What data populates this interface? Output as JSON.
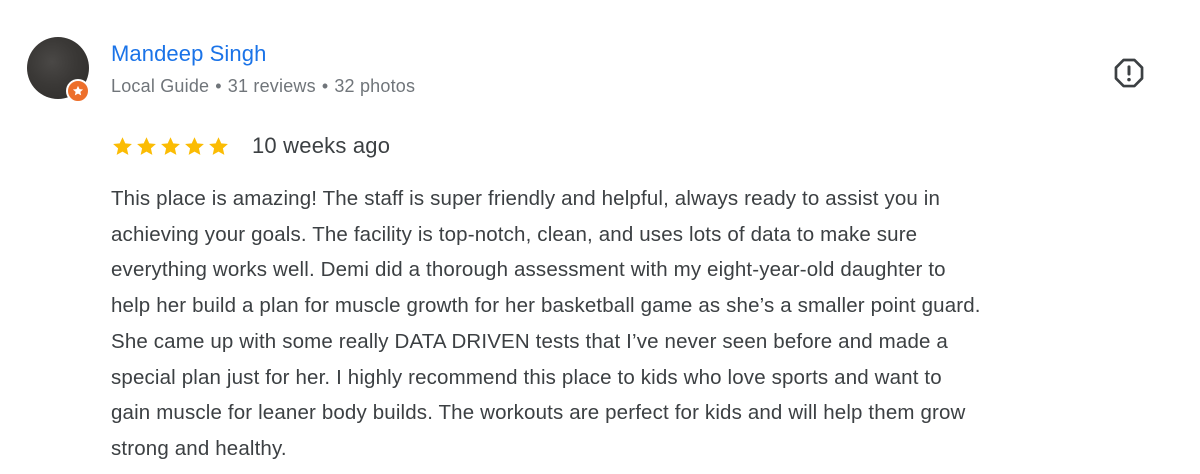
{
  "review": {
    "author": {
      "name": "Mandeep Singh",
      "badge_icon": "local-guide-star-icon",
      "meta": {
        "level": "Local Guide",
        "reviews": "31 reviews",
        "photos": "32 photos",
        "separator": "•"
      }
    },
    "report_icon": "report-octagon-icon",
    "rating": {
      "stars": 5,
      "max": 5,
      "star_color": "#fbbc04"
    },
    "time_ago": "10 weeks ago",
    "text": "This place is amazing! The staff is super friendly and helpful, always ready to assist you in\nachieving your goals. The facility is top-notch, clean, and uses lots of data to make sure\neverything works well. Demi did a thorough assessment with my eight-year-old daughter to\nhelp her build a plan for muscle growth for her basketball game as she’s a smaller point guard.\nShe came up with some really DATA DRIVEN tests that I’ve never seen before and made a\nspecial plan just for her. I highly recommend this place to kids who love sports and want to\ngain muscle for leaner body builds. The workouts are perfect for kids and will help them grow\nstrong and healthy.",
    "colors": {
      "author_name": "#1a73e8",
      "meta_text": "#70757a",
      "body_text": "#3c4043",
      "badge": "#ed6f2b"
    }
  }
}
